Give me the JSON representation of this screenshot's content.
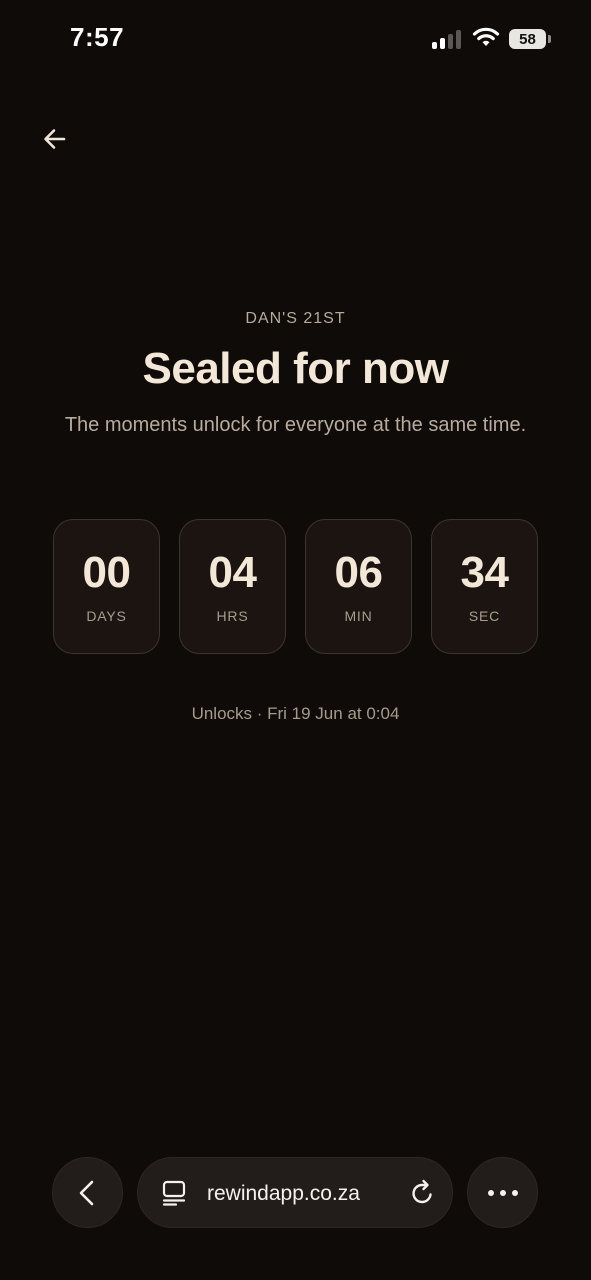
{
  "status_bar": {
    "time": "7:57",
    "battery_level": "58",
    "signal_bars": 2,
    "icons": [
      "signal-icon",
      "wifi-icon",
      "battery-icon"
    ]
  },
  "header": {
    "back_icon": "arrow-left-icon"
  },
  "event": {
    "eyebrow": "DAN'S 21ST",
    "title": "Sealed for now",
    "subtitle": "The moments unlock for everyone at the same time."
  },
  "countdown": {
    "days": {
      "value": "00",
      "unit": "DAYS"
    },
    "hours": {
      "value": "04",
      "unit": "HRS"
    },
    "minutes": {
      "value": "06",
      "unit": "MIN"
    },
    "seconds": {
      "value": "34",
      "unit": "SEC"
    }
  },
  "unlocks_text": "Unlocks · Fri 19 Jun at 0:04",
  "browser": {
    "url": "rewindapp.co.za",
    "icons": [
      "chevron-left-icon",
      "tabs-icon",
      "reload-icon",
      "more-icon"
    ]
  },
  "colors": {
    "background": "#0f0b09",
    "title": "#f3e8d8",
    "muted": "#b7ab9c",
    "card_bg": "#1b1410",
    "card_border": "#3d342d"
  }
}
